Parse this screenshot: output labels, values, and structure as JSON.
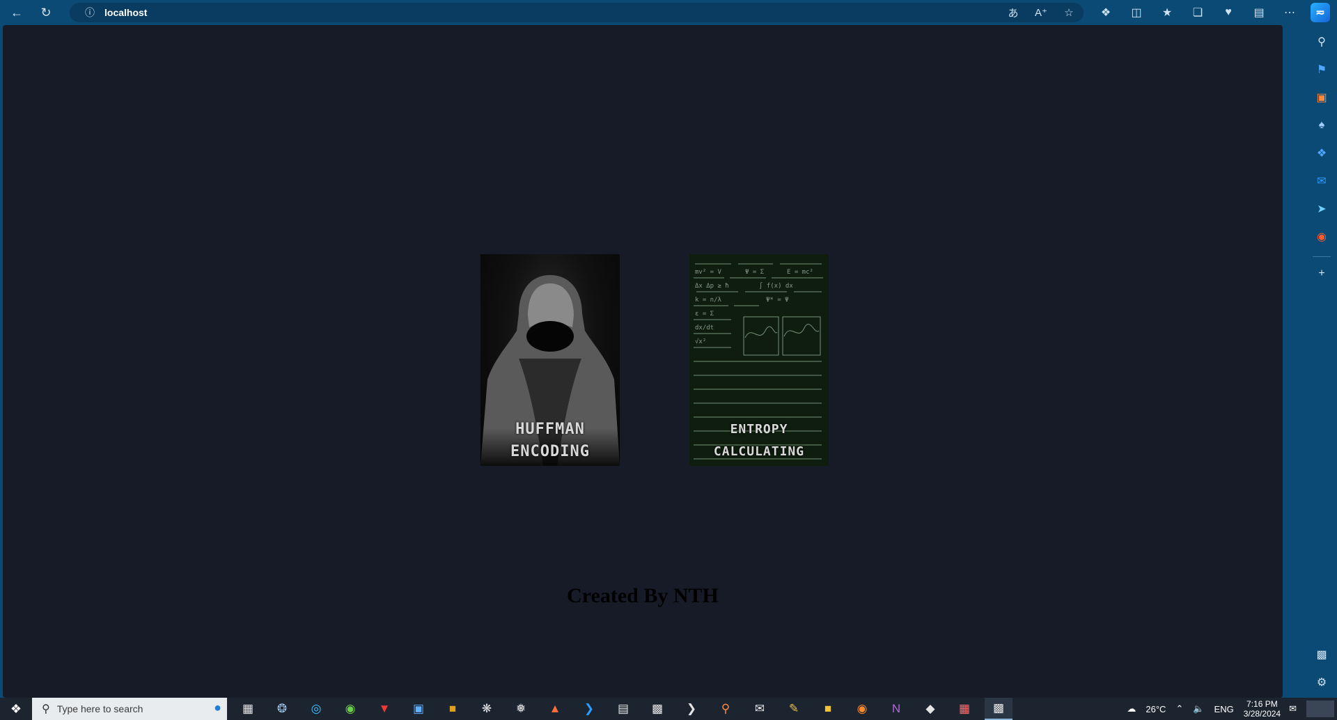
{
  "browser": {
    "url": "localhost",
    "back_icon": "back-arrow-icon",
    "refresh_icon": "refresh-icon"
  },
  "cards": [
    {
      "line1": "HUFFMAN",
      "line2": "ENCODING"
    },
    {
      "line1": "ENTROPY",
      "line2": "CALCULATING"
    }
  ],
  "footer": {
    "credit": "Created By NTH"
  },
  "taskbar": {
    "search_placeholder": "Type here to search",
    "weather": "26°C",
    "language": "ENG",
    "time": "7:16 PM",
    "date": "3/28/2024"
  },
  "colors": {
    "browser_chrome": "#0b4a75",
    "page_background": "#171b27",
    "credit_text": "#000000"
  }
}
